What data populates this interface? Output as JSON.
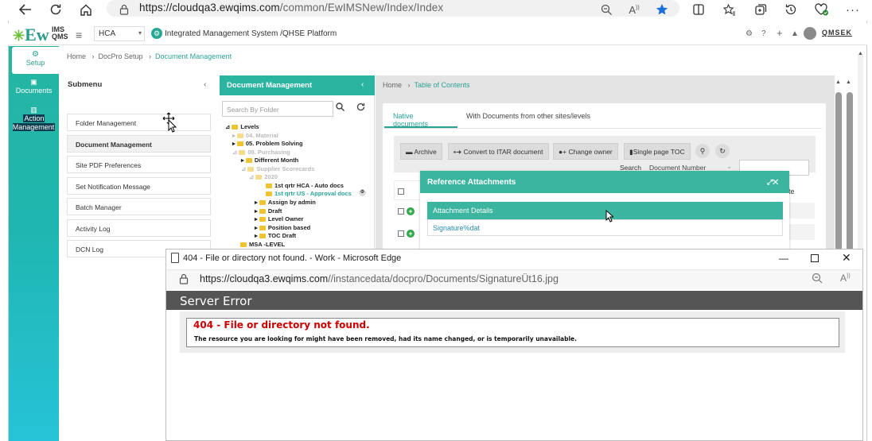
{
  "browser": {
    "url_host": "https://cloudqa3.ewqims.com",
    "url_path": "/common/EwIMSNew/Index/Index"
  },
  "header": {
    "logo_text": "Ew",
    "logo_sup": "IMS",
    "logo_sub": "QMS",
    "site_value": "HCA",
    "platform_title": "Integrated Management System /QHSE Platform",
    "brand_right": "QMSEK"
  },
  "left_nav": {
    "items": [
      {
        "label": "Setup",
        "icon": "gears-icon"
      },
      {
        "label": "Documents",
        "icon": "documents-icon"
      },
      {
        "label": "Action Management",
        "icon": "building-icon"
      }
    ]
  },
  "breadcrumb_top": {
    "home": "Home",
    "mid": "DocPro Setup",
    "current": "Document Management"
  },
  "submenu": {
    "title": "Submenu",
    "items": [
      "Folder Management",
      "Document Management",
      "Site PDF Preferences",
      "Set Notification Message",
      "Batch Manager",
      "Activity Log",
      "DCN Log"
    ],
    "active_index": 1
  },
  "doc_panel": {
    "title": "Document Management",
    "search_placeholder": "Search By Folder",
    "tree": [
      "Levels",
      "04. Material",
      "05. Problem Solving",
      "09. Purchasing",
      "Different Month",
      "Supplier Scorecards",
      "2020",
      "1st qrtr HCA - Auto docs",
      "1st qrtr US - Approval docs",
      "Assign by admin",
      "Draft",
      "Level Owner",
      "Position based",
      "TOC Draft",
      "MSA -LEVEL"
    ]
  },
  "breadcrumb_right": {
    "home": "Home",
    "current": "Table of Contents"
  },
  "tabs": {
    "native": "Native documents",
    "other": "With Documents from other sites/levels"
  },
  "toolbar": {
    "archive": "Archive",
    "convert": "Convert to ITAR document",
    "change_owner": "Change owner",
    "single_toc": "Single page TOC",
    "search_label": "Search",
    "search_by": "Document Number"
  },
  "table": {
    "col_date_fragment": "ate"
  },
  "ref_modal": {
    "title": "Reference Attachments",
    "attach_header": "Attachment Details",
    "attach_item": "Signature%dat"
  },
  "popup": {
    "title": "404 - File or directory not found. - Work - Microsoft Edge",
    "url_host": "https://cloudqa3.ewqims.com",
    "url_path": "//instancedata/docpro/Documents/SignatureÜt16.jpg",
    "server_bar": "Server Error",
    "error_title": "404 - File or directory not found.",
    "error_message": "The resource you are looking for might have been removed, had its name changed, or is temporarily unavailable."
  }
}
